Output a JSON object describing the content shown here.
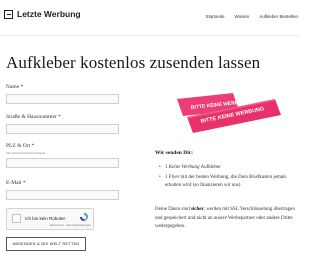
{
  "header": {
    "logo_text": "Letzte Werbung",
    "nav": [
      "Startseite",
      "Wissen",
      "Aufkleber Bestellen"
    ]
  },
  "page_title": "Aufkleber kostenlos zusenden lassen",
  "form": {
    "fields": [
      {
        "label": "Name *",
        "value": ""
      },
      {
        "label": "Straße & Hausnummer *",
        "value": ""
      },
      {
        "label": "PLZ & Ort *",
        "sublabel": "Nur innerhalb Deutschlands",
        "value": ""
      },
      {
        "label": "E-Mail *",
        "value": ""
      }
    ],
    "captcha": {
      "text": "Ich bin kein Roboter.",
      "privacy": "Datenschutz - Nutzungsbedingungen"
    },
    "submit_label": "ABSENDEN & BIS WELT RETTEN"
  },
  "promo": {
    "sticker_text_1": "BITTE KEINE WERBUNG",
    "sticker_text_2": "BITTE KEINE WERBUNG",
    "sticker_color": "#e8306a"
  },
  "info": {
    "title": "Wir senden Dir:",
    "items": [
      {
        "prefix": "1 ",
        "emph": "Keine Werbung",
        "suffix": " Aufkleber"
      },
      {
        "prefix": "1 Flyer mit der besten Werbung, die Dein Briefkasten jemals erhalten wird (so finanzieren wir uns)",
        "emph": "",
        "suffix": ""
      }
    ],
    "privacy_pre": "Deine Daten sind ",
    "privacy_bold": "sicher",
    "privacy_post": ", werden mit SSL Verschlüsselung übertragen und gespeichert und nicht an unsere Werbepartner oder andere Dritte weitergegeben."
  }
}
